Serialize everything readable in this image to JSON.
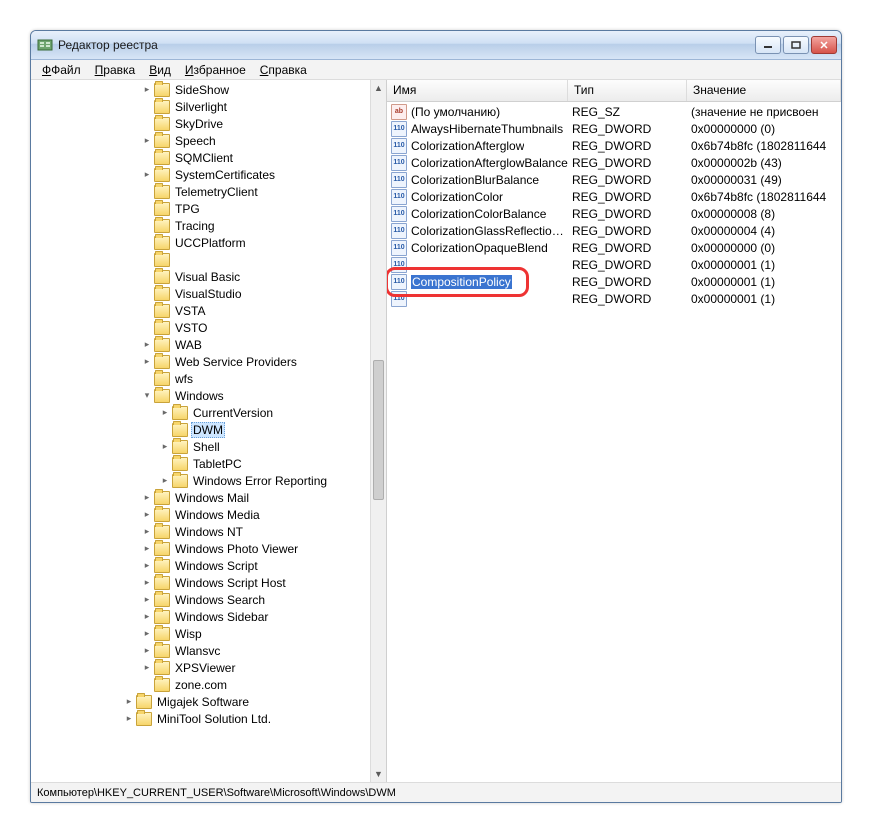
{
  "title": "Редактор реестра",
  "menu": {
    "file": "Файл",
    "edit": "Правка",
    "view": "Вид",
    "favorites": "Избранное",
    "help": "Справка"
  },
  "columns": {
    "name": "Имя",
    "type": "Тип",
    "value": "Значение"
  },
  "statusbar": "Компьютер\\HKEY_CURRENT_USER\\Software\\Microsoft\\Windows\\DWM",
  "tree": [
    {
      "l": 5,
      "e": "r",
      "n": "SideShow"
    },
    {
      "l": 5,
      "e": "",
      "n": "Silverlight"
    },
    {
      "l": 5,
      "e": "",
      "n": "SkyDrive"
    },
    {
      "l": 5,
      "e": "r",
      "n": "Speech"
    },
    {
      "l": 5,
      "e": "",
      "n": "SQMClient"
    },
    {
      "l": 5,
      "e": "r",
      "n": "SystemCertificates"
    },
    {
      "l": 5,
      "e": "",
      "n": "TelemetryClient"
    },
    {
      "l": 5,
      "e": "",
      "n": "TPG"
    },
    {
      "l": 5,
      "e": "",
      "n": "Tracing"
    },
    {
      "l": 5,
      "e": "",
      "n": "UCCPlatform"
    },
    {
      "l": 5,
      "e": "",
      "n": ""
    },
    {
      "l": 5,
      "e": "",
      "n": "Visual Basic"
    },
    {
      "l": 5,
      "e": "",
      "n": "VisualStudio"
    },
    {
      "l": 5,
      "e": "",
      "n": "VSTA"
    },
    {
      "l": 5,
      "e": "",
      "n": "VSTO"
    },
    {
      "l": 5,
      "e": "r",
      "n": "WAB"
    },
    {
      "l": 5,
      "e": "r",
      "n": "Web Service Providers"
    },
    {
      "l": 5,
      "e": "",
      "n": "wfs"
    },
    {
      "l": 5,
      "e": "d",
      "n": "Windows"
    },
    {
      "l": 6,
      "e": "r",
      "n": "CurrentVersion"
    },
    {
      "l": 6,
      "e": "",
      "n": "DWM",
      "sel": true
    },
    {
      "l": 6,
      "e": "r",
      "n": "Shell"
    },
    {
      "l": 6,
      "e": "",
      "n": "TabletPC"
    },
    {
      "l": 6,
      "e": "r",
      "n": "Windows Error Reporting"
    },
    {
      "l": 5,
      "e": "r",
      "n": "Windows Mail"
    },
    {
      "l": 5,
      "e": "r",
      "n": "Windows Media"
    },
    {
      "l": 5,
      "e": "r",
      "n": "Windows NT"
    },
    {
      "l": 5,
      "e": "r",
      "n": "Windows Photo Viewer"
    },
    {
      "l": 5,
      "e": "r",
      "n": "Windows Script"
    },
    {
      "l": 5,
      "e": "r",
      "n": "Windows Script Host"
    },
    {
      "l": 5,
      "e": "r",
      "n": "Windows Search"
    },
    {
      "l": 5,
      "e": "r",
      "n": "Windows Sidebar"
    },
    {
      "l": 5,
      "e": "r",
      "n": "Wisp"
    },
    {
      "l": 5,
      "e": "r",
      "n": "Wlansvc"
    },
    {
      "l": 5,
      "e": "r",
      "n": "XPSViewer"
    },
    {
      "l": 5,
      "e": "",
      "n": "zone.com"
    },
    {
      "l": 4,
      "e": "r",
      "n": "Migajek Software"
    },
    {
      "l": 4,
      "e": "r",
      "n": "MiniTool Solution Ltd."
    }
  ],
  "values": [
    {
      "icon": "string",
      "name": "(По умолчанию)",
      "type": "REG_SZ",
      "value": "(значение не присвоен"
    },
    {
      "icon": "dword",
      "name": "AlwaysHibernateThumbnails",
      "type": "REG_DWORD",
      "value": "0x00000000 (0)"
    },
    {
      "icon": "dword",
      "name": "ColorizationAfterglow",
      "type": "REG_DWORD",
      "value": "0x6b74b8fc (1802811644"
    },
    {
      "icon": "dword",
      "name": "ColorizationAfterglowBalance",
      "type": "REG_DWORD",
      "value": "0x0000002b (43)"
    },
    {
      "icon": "dword",
      "name": "ColorizationBlurBalance",
      "type": "REG_DWORD",
      "value": "0x00000031 (49)"
    },
    {
      "icon": "dword",
      "name": "ColorizationColor",
      "type": "REG_DWORD",
      "value": "0x6b74b8fc (1802811644"
    },
    {
      "icon": "dword",
      "name": "ColorizationColorBalance",
      "type": "REG_DWORD",
      "value": "0x00000008 (8)"
    },
    {
      "icon": "dword",
      "name": "ColorizationGlassReflectionI...",
      "type": "REG_DWORD",
      "value": "0x00000004 (4)"
    },
    {
      "icon": "dword",
      "name": "ColorizationOpaqueBlend",
      "type": "REG_DWORD",
      "value": "0x00000000 (0)"
    },
    {
      "icon": "dword",
      "name": "",
      "type": "REG_DWORD",
      "value": "0x00000001 (1)",
      "hidden": true
    },
    {
      "icon": "dword",
      "name": "CompositionPolicy",
      "type": "REG_DWORD",
      "value": "0x00000001 (1)",
      "edit": true
    },
    {
      "icon": "dword",
      "name": "",
      "type": "REG_DWORD",
      "value": "0x00000001 (1)",
      "hidden": true
    }
  ]
}
